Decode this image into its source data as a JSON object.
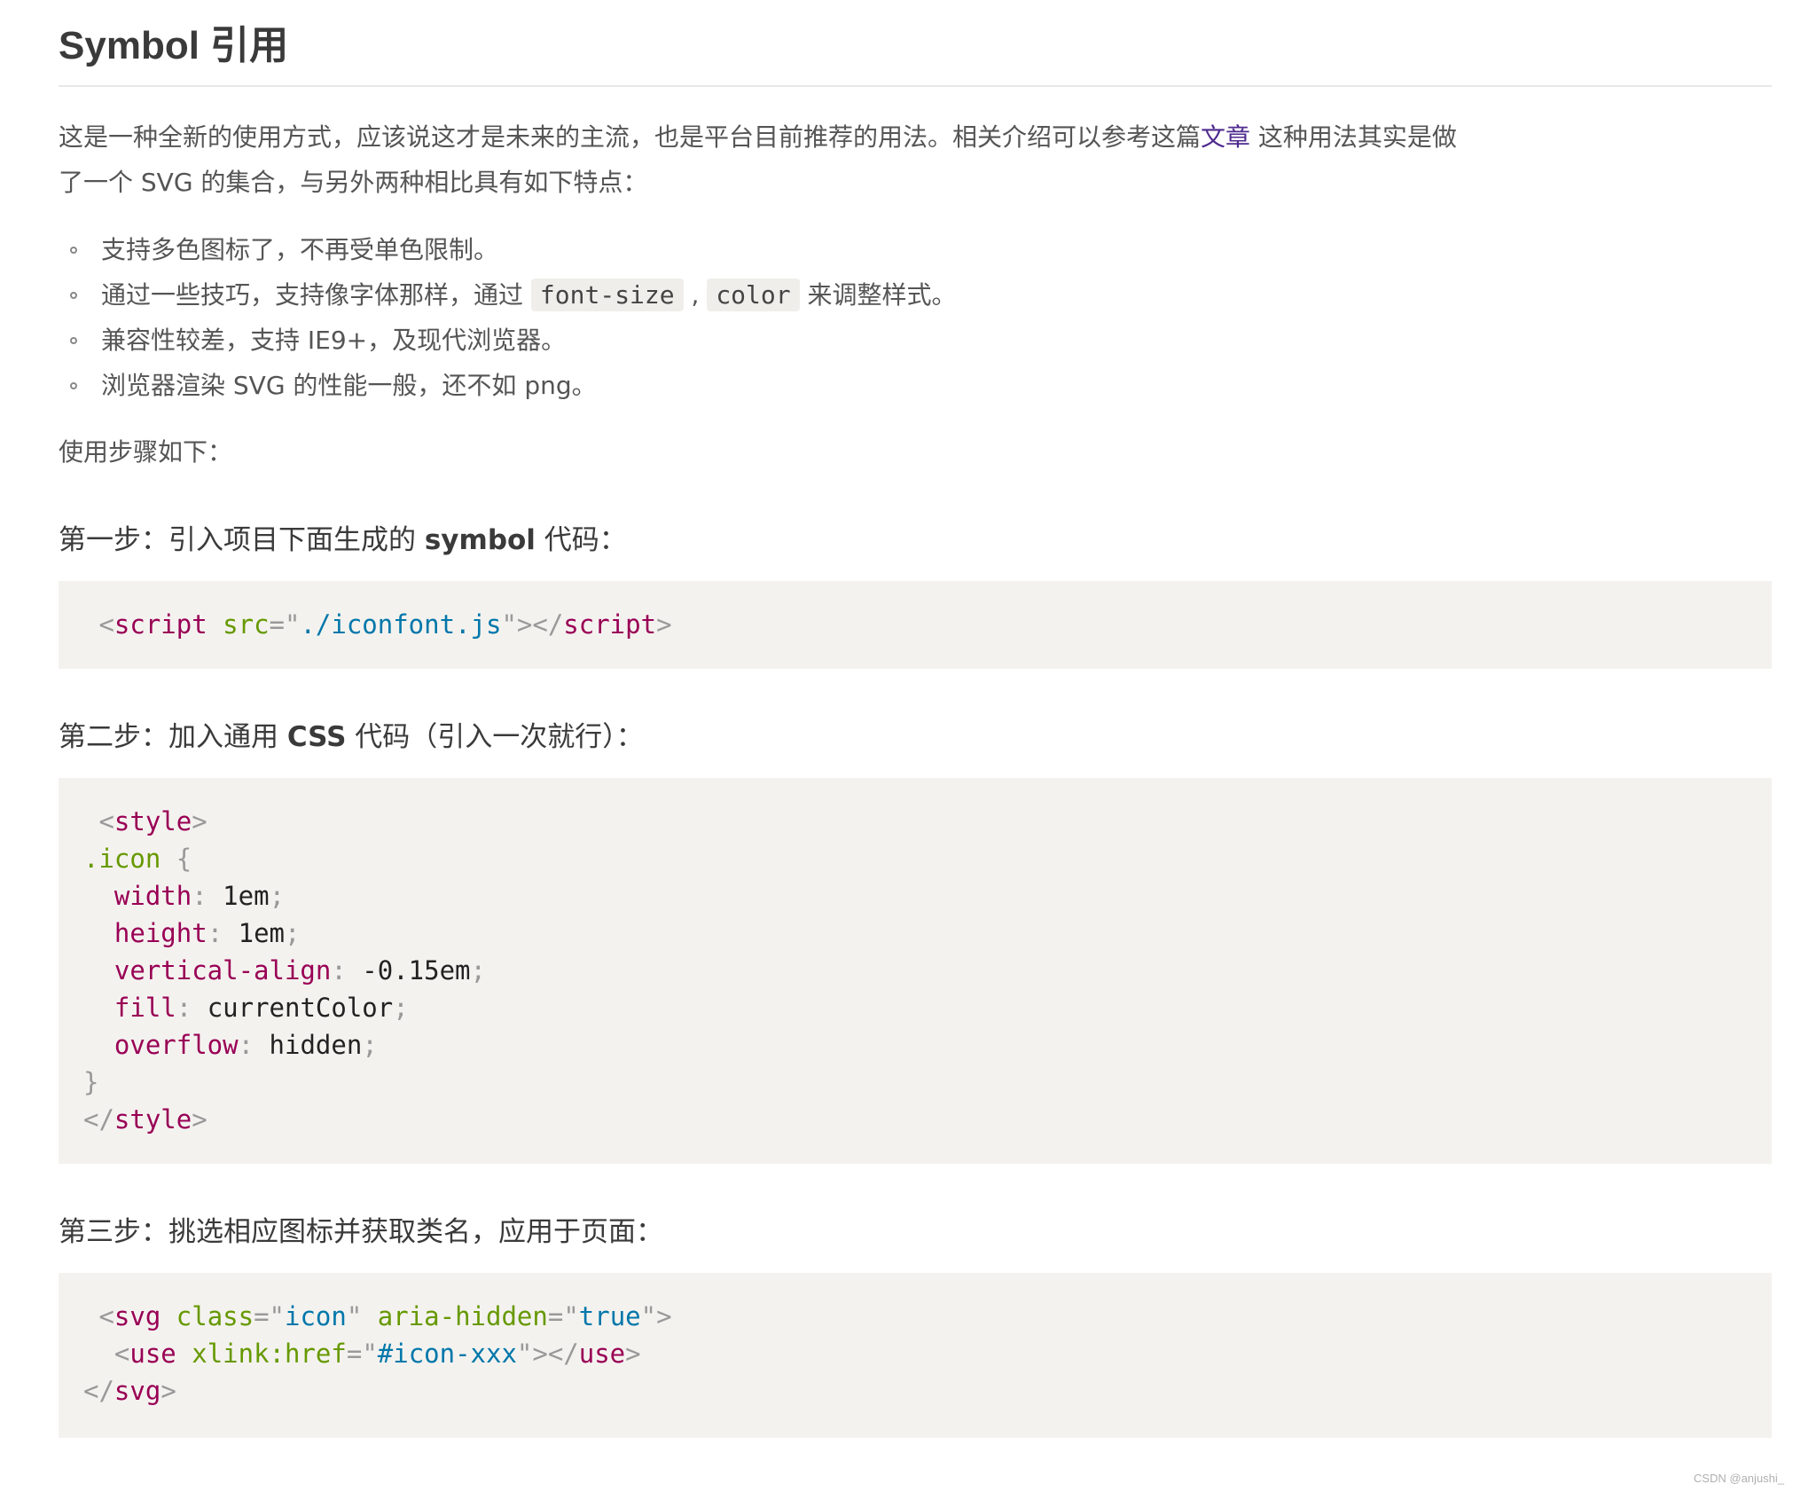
{
  "title": "Symbol 引用",
  "intro": {
    "text_before_link": "这是一种全新的使用方式，应该说这才是未来的主流，也是平台目前推荐的用法。相关介绍可以参考这篇",
    "link_text": "文章",
    "text_after_link": " 这种用法其实是做了一个 SVG 的集合，与另外两种相比具有如下特点："
  },
  "features": [
    {
      "text": "支持多色图标了，不再受单色限制。"
    },
    {
      "before": "通过一些技巧，支持像字体那样，通过 ",
      "code1": "font-size",
      "middle": " , ",
      "code2": "color",
      "after": " 来调整样式。"
    },
    {
      "text": "兼容性较差，支持 IE9+，及现代浏览器。"
    },
    {
      "text": "浏览器渲染 SVG 的性能一般，还不如 png。"
    }
  ],
  "steps_intro": "使用步骤如下：",
  "step1": {
    "prefix": "第一步：引入项目下面生成的 ",
    "bold": "symbol",
    "suffix": " 代码："
  },
  "code1": {
    "tag_open": "script",
    "attr": "src",
    "value": "./iconfont.js",
    "tag_close": "script"
  },
  "step2": {
    "prefix": "第二步：加入通用 ",
    "bold": "CSS",
    "suffix": " 代码（引入一次就行）："
  },
  "code2": {
    "tag": "style",
    "selector": ".icon",
    "declarations": [
      {
        "prop": "width",
        "value": "1em"
      },
      {
        "prop": "height",
        "value": "1em"
      },
      {
        "prop": "vertical-align",
        "value": "-0.15em"
      },
      {
        "prop": "fill",
        "value": "currentColor"
      },
      {
        "prop": "overflow",
        "value": "hidden"
      }
    ]
  },
  "step3": {
    "text": "第三步：挑选相应图标并获取类名，应用于页面："
  },
  "code3": {
    "svg_tag": "svg",
    "class_attr": "class",
    "class_value": "icon",
    "aria_attr": "aria-hidden",
    "aria_value": "true",
    "use_tag": "use",
    "href_attr": "xlink:href",
    "href_value": "#icon-xxx"
  },
  "watermark": "CSDN @anjushi_"
}
